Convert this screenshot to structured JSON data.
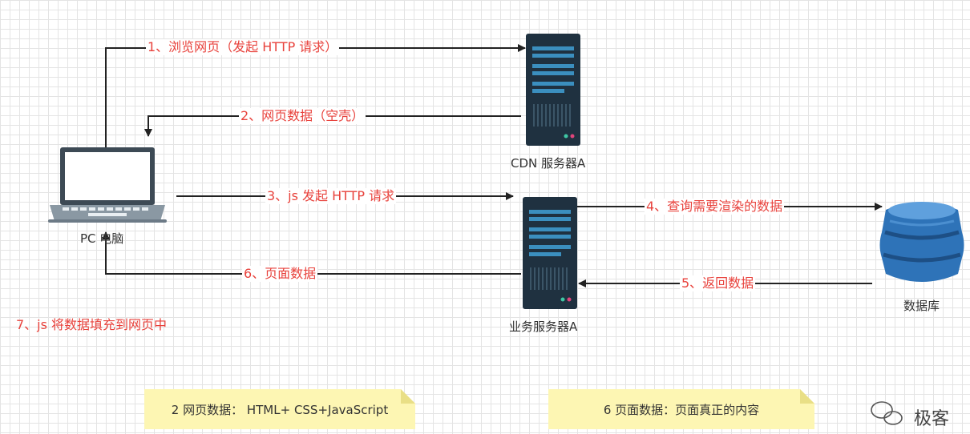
{
  "nodes": {
    "pc": "PC 电脑",
    "cdn": "CDN 服务器A",
    "biz": "业务服务器A",
    "db": "数据库"
  },
  "steps": {
    "s1": "1、浏览网页（发起 HTTP 请求）",
    "s2": "2、网页数据（空壳）",
    "s3": "3、js 发起 HTTP 请求",
    "s4": "4、查询需要渲染的数据",
    "s5": "5、返回数据",
    "s6": "6、页面数据",
    "s7": "7、js 将数据填充到网页中"
  },
  "notes": {
    "n1": "2 网页数据： HTML+ CSS+JavaScript",
    "n2": "6 页面数据：页面真正的内容"
  },
  "watermark": "极客",
  "colors": {
    "arrow": "#222222",
    "step_text": "#e8423c",
    "server": "#1f3140",
    "server_bar": "#3b8fbf",
    "database": "#2e73b8",
    "note_bg": "#fdf6b3"
  }
}
